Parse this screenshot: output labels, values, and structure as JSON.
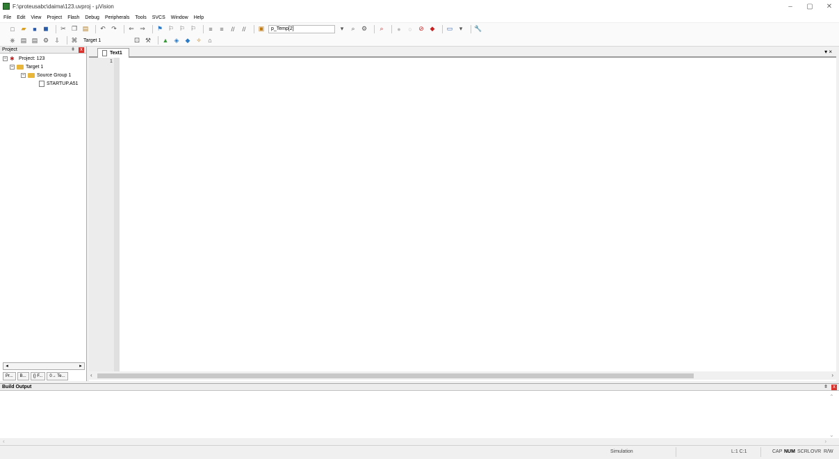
{
  "window": {
    "title": "F:\\proteusabc\\daima\\123.uvproj - µVision",
    "controls": [
      "–",
      "▢",
      "✕"
    ]
  },
  "menu": [
    "File",
    "Edit",
    "View",
    "Project",
    "Flash",
    "Debug",
    "Peripherals",
    "Tools",
    "SVCS",
    "Window",
    "Help"
  ],
  "toolbar": {
    "combo_value": "p_Temp[2]",
    "target_value": "Target 1"
  },
  "project_panel": {
    "title": "Project",
    "tree": {
      "project": "Project: 123",
      "target": "Target 1",
      "group": "Source Group 1",
      "file": "STARTUP.A51"
    },
    "tabs": [
      "Pr...",
      "B...",
      "{} F...",
      "0→ Te..."
    ]
  },
  "editor": {
    "tab_label": "Text1",
    "line_number": "1"
  },
  "build_output": {
    "title": "Build Output"
  },
  "status": {
    "mode": "Simulation",
    "position": "L:1 C:1",
    "indicators": [
      "CAP",
      "NUM",
      "SCRL",
      "OVR",
      "R/W"
    ]
  }
}
